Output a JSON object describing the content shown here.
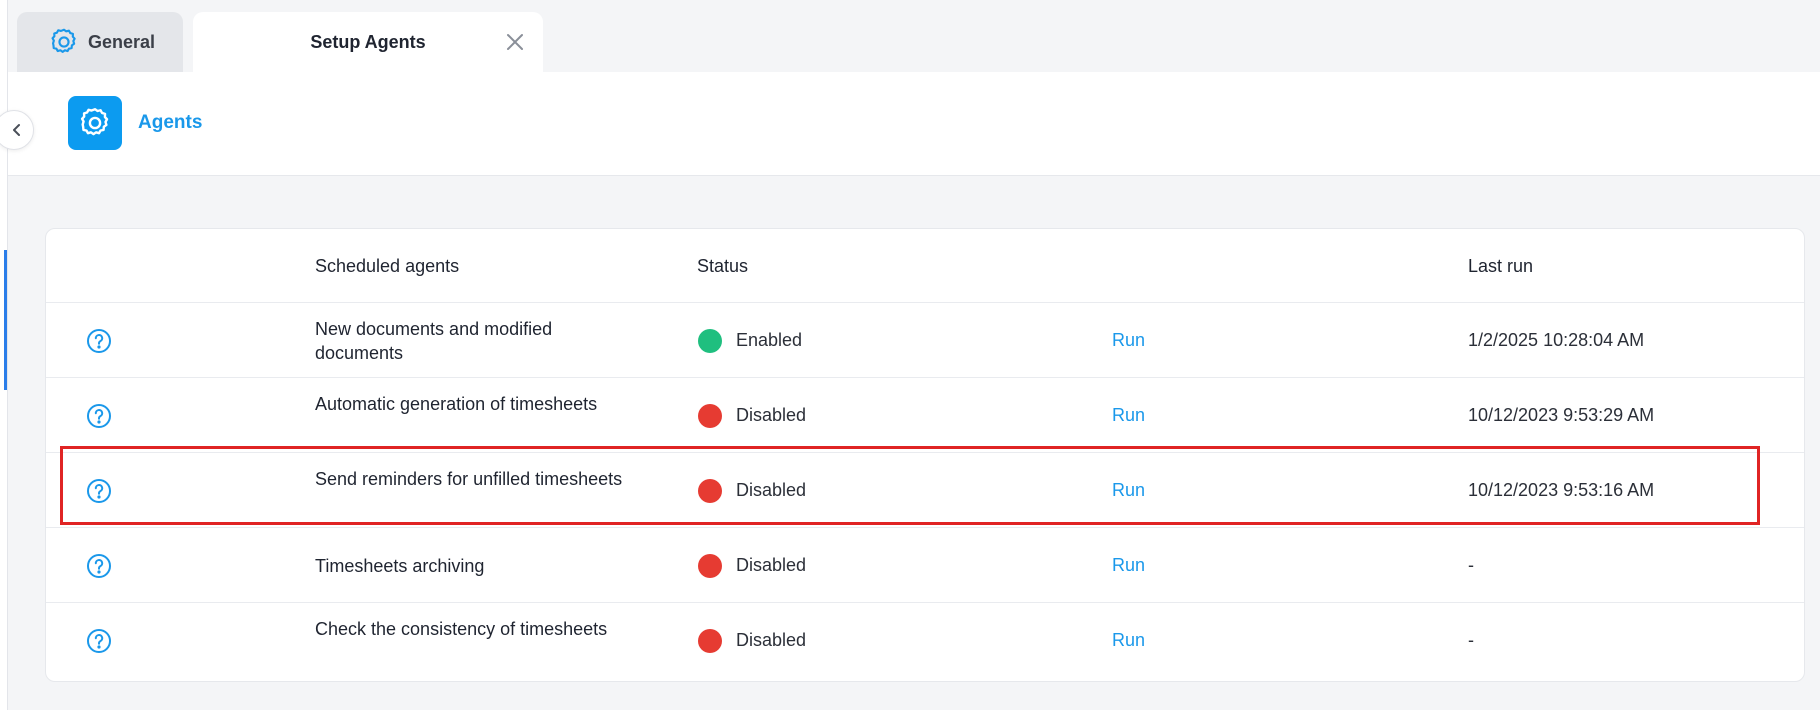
{
  "tabs": [
    {
      "label": "General",
      "icon": "gear-icon",
      "active": false
    },
    {
      "label": "Setup Agents",
      "active": true,
      "closable": true
    }
  ],
  "header": {
    "title": "Agents",
    "icon": "gear-icon",
    "accent_color": "#0c9bf0"
  },
  "table": {
    "columns": [
      "",
      "Scheduled agents",
      "Status",
      "",
      "Last run"
    ],
    "rows": [
      {
        "name": "New documents and modified documents",
        "status": "Enabled",
        "status_color": "#1fbf7f",
        "action": "Run",
        "last_run": "1/2/2025 10:28:04 AM"
      },
      {
        "name": "Automatic generation of timesheets",
        "status": "Disabled",
        "status_color": "#e63b32",
        "action": "Run",
        "last_run": "10/12/2023 9:53:29 AM"
      },
      {
        "name": "Send reminders for unfilled timesheets",
        "status": "Disabled",
        "status_color": "#e63b32",
        "action": "Run",
        "last_run": "10/12/2023 9:53:16 AM"
      },
      {
        "name": "Timesheets archiving",
        "status": "Disabled",
        "status_color": "#e63b32",
        "action": "Run",
        "last_run": "-"
      },
      {
        "name": "Check the consistency of timesheets",
        "status": "Disabled",
        "status_color": "#e63b32",
        "action": "Run",
        "last_run": "-"
      }
    ]
  },
  "highlight": {
    "color": "#e02424"
  }
}
